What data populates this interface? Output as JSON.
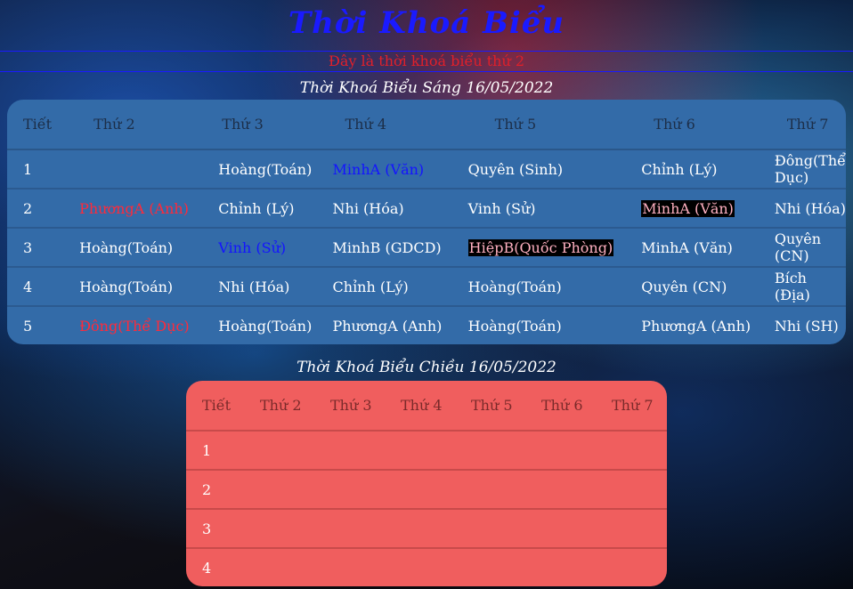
{
  "page": {
    "title": "Thời Khoá Biểu",
    "subtitle": "Đây là thời khoá biểu thứ 2",
    "morning_title": "Thời Khoá Biểu Sáng 16/05/2022",
    "afternoon_title": "Thời Khoá Biểu Chiều 16/05/2022"
  },
  "colors": {
    "title": "#1a1aff",
    "subtitle": "#e0202a",
    "morning_bg": "#336ba8",
    "afternoon_bg": "#f05e5e"
  },
  "morning": {
    "headers": [
      "Tiết",
      "Thứ 2",
      "Thứ 3",
      "Thứ 4",
      "Thứ 5",
      "Thứ 6",
      "Thứ 7"
    ],
    "rows": [
      [
        "1",
        "",
        "Hoàng(Toán)",
        "MinhA (Văn)",
        "Quyên (Sinh)",
        "Chỉnh (Lý)",
        "Đông(Thể Dục)"
      ],
      [
        "2",
        "PhươngA (Anh)",
        "Chỉnh (Lý)",
        "Nhi (Hóa)",
        "Vinh (Sử)",
        "MinhA (Văn)",
        "Nhi (Hóa)"
      ],
      [
        "3",
        "Hoàng(Toán)",
        "Vinh (Sử)",
        "MinhB (GDCD)",
        "HiệpB(Quốc Phòng)",
        "MinhA (Văn)",
        "Quyên (CN)"
      ],
      [
        "4",
        "Hoàng(Toán)",
        "Nhi (Hóa)",
        "Chỉnh (Lý)",
        "Hoàng(Toán)",
        "Quyên (CN)",
        "Bích (Địa)"
      ],
      [
        "5",
        "Đông(Thể Dục)",
        "Hoàng(Toán)",
        "PhươngA (Anh)",
        "Hoàng(Toán)",
        "PhươngA (Anh)",
        "Nhi (SH)"
      ]
    ]
  },
  "afternoon": {
    "headers": [
      "Tiết",
      "Thứ 2",
      "Thứ 3",
      "Thứ 4",
      "Thứ 5",
      "Thứ 6",
      "Thứ 7"
    ],
    "rows": [
      [
        "1",
        "",
        "",
        "",
        "",
        "",
        ""
      ],
      [
        "2",
        "",
        "",
        "",
        "",
        "",
        ""
      ],
      [
        "3",
        "",
        "",
        "",
        "",
        "",
        ""
      ],
      [
        "4",
        "",
        "",
        "",
        "",
        "",
        ""
      ]
    ]
  }
}
